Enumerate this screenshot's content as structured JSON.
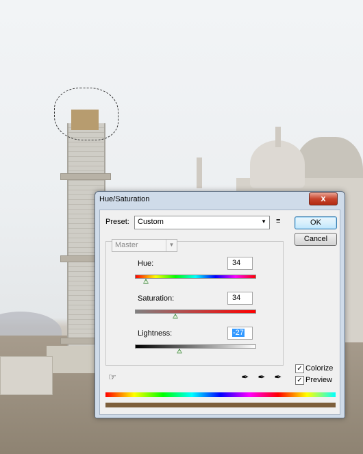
{
  "dialog": {
    "title": "Hue/Saturation",
    "close_label": "x",
    "preset_label": "Preset:",
    "preset_value": "Custom",
    "preset_menu_icon": "list-options-icon",
    "ok_label": "OK",
    "cancel_label": "Cancel",
    "edit_value": "Master",
    "hue_label": "Hue:",
    "hue_value": "34",
    "saturation_label": "Saturation:",
    "saturation_value": "34",
    "lightness_label": "Lightness:",
    "lightness_value": "-27",
    "colorize_label": "Colorize",
    "colorize_checked": true,
    "preview_label": "Preview",
    "preview_checked": true,
    "hand_tool_icon": "targeted-adjustment-icon",
    "eyedropper_icons": [
      "eyedropper-icon",
      "eyedropper-plus-icon",
      "eyedropper-minus-icon"
    ],
    "result_color": "#7d5f3c",
    "accent": "#3399ff"
  }
}
